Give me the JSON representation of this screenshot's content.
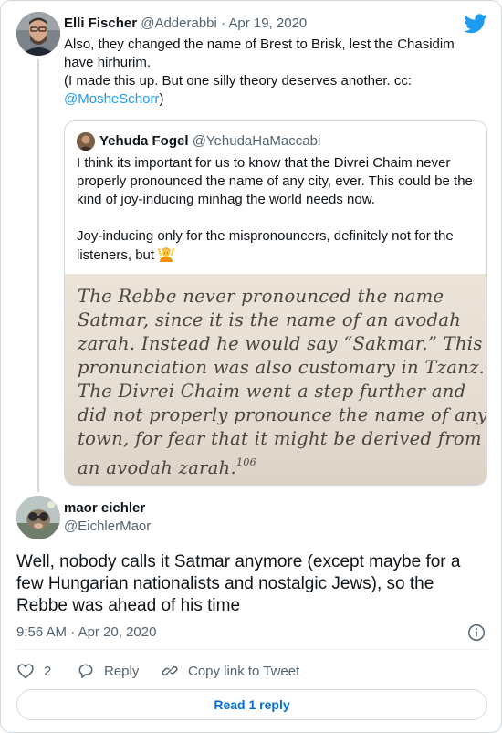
{
  "colors": {
    "link": "#1d9bf0",
    "muted": "#536471",
    "text": "#0f1419",
    "border": "#cfd9de",
    "read_reply": "#006fd6"
  },
  "tweet1": {
    "author_name": "Elli Fischer",
    "author_handle": "@Adderabbi",
    "separator": "·",
    "date": "Apr 19, 2020",
    "lines": [
      "Also, they changed the name of Brest to Brisk, lest the Chasidim",
      "have hirhurim.",
      "(I made this up. But one silly theory deserves another. cc:"
    ],
    "mention": "@MosheSchorr",
    "mention_suffix": ")"
  },
  "quoted": {
    "author_name": "Yehuda Fogel",
    "author_handle": "@YehudaHaMaccabi",
    "para1": [
      "I think its important for us to know that the Divrei Chaim never",
      "properly pronounced the name of any city, ever. This could be the",
      "kind of joy-inducing minhag the world needs now."
    ],
    "para2": [
      "Joy-inducing only for the mispronouncers, definitely not for the"
    ],
    "para2_last": "listeners, but",
    "emoji_icon": "person-gesturing-ok-emoji",
    "image_text": [
      "The Rebbe never pronounced the name",
      "Satmar, since it is the name of an avodah",
      "zarah. Instead he would say “Sakmar.” This",
      "pronunciation was also customary in Tzanz.",
      "The Divrei Chaim went a step further and",
      "did not properly pronounce the name of any",
      "town, for fear that it might be derived from"
    ],
    "image_last": "an avodah zarah.",
    "image_footnote": "106"
  },
  "reply": {
    "author_name": "maor eichler",
    "author_handle": "@EichlerMaor",
    "lines": [
      "Well, nobody calls it Satmar anymore (except maybe for a",
      "few Hungarian nationalists and nostalgic Jews), so the",
      "Rebbe was ahead of his time"
    ],
    "time": "9:56 AM",
    "separator": "·",
    "date": "Apr 20, 2020"
  },
  "actions": {
    "like_count": "2",
    "reply_label": "Reply",
    "copy_label": "Copy link to Tweet"
  },
  "read_reply_label": "Read 1 reply",
  "icons": [
    "twitter-bird-icon",
    "info-icon",
    "heart-icon",
    "reply-icon",
    "link-icon"
  ]
}
